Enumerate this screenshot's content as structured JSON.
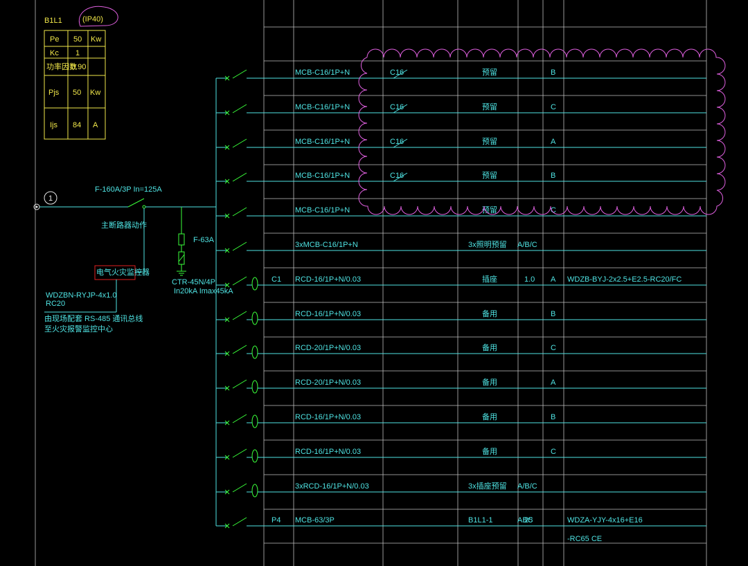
{
  "panel": {
    "name": "B1L1",
    "ip": "(IP40)",
    "table": [
      [
        "Pe",
        "50",
        "Kw"
      ],
      [
        "Kc",
        "1",
        ""
      ],
      [
        "功率因数",
        "0.90",
        ""
      ],
      [
        "Pjs",
        "50",
        "Kw"
      ],
      [
        "Ijs",
        "84",
        "A"
      ]
    ]
  },
  "incoming": {
    "circle_label": "1",
    "breaker": "F-160A/3P In=125A",
    "breaker_note": "主断路器动作",
    "fuse": "F-63A",
    "spd": "CTR-45N/4P",
    "spd_note": "In20kA Imax45kA",
    "monitor": "电气火灾监控器",
    "cable": "WDZBN-RYJP-4x1.0",
    "cable2": "RC20",
    "note1": "由现场配套 RS-485 通讯总线",
    "note2": "至火灾报警监控中心"
  },
  "circuits": [
    {
      "no": "",
      "device": "MCB-C16/1P+N",
      "cloud_device": "C16",
      "use": "预留",
      "kw": "",
      "phase": "B",
      "cable": "",
      "type": "mcb"
    },
    {
      "no": "",
      "device": "MCB-C16/1P+N",
      "cloud_device": "C16",
      "use": "预留",
      "kw": "",
      "phase": "C",
      "cable": "",
      "type": "mcb"
    },
    {
      "no": "",
      "device": "MCB-C16/1P+N",
      "cloud_device": "C16",
      "use": "预留",
      "kw": "",
      "phase": "A",
      "cable": "",
      "type": "mcb"
    },
    {
      "no": "",
      "device": "MCB-C16/1P+N",
      "cloud_device": "C16",
      "use": "预留",
      "kw": "",
      "phase": "B",
      "cable": "",
      "type": "mcb"
    },
    {
      "no": "",
      "device": "MCB-C16/1P+N",
      "cloud_device": "",
      "use": "预留",
      "kw": "",
      "phase": "C",
      "cable": "",
      "type": "mcb"
    },
    {
      "no": "",
      "device": "3xMCB-C16/1P+N",
      "cloud_device": "",
      "use": "3x照明预留",
      "kw": "",
      "phase": "A/B/C",
      "cable": "",
      "type": "mcb"
    },
    {
      "no": "C1",
      "device": "RCD-16/1P+N/0.03",
      "cloud_device": "",
      "use": "插座",
      "kw": "1.0",
      "phase": "A",
      "cable": "WDZB-BYJ-2x2.5+E2.5-RC20/FC",
      "type": "rcd"
    },
    {
      "no": "",
      "device": "RCD-16/1P+N/0.03",
      "cloud_device": "",
      "use": "备用",
      "kw": "",
      "phase": "B",
      "cable": "",
      "type": "rcd"
    },
    {
      "no": "",
      "device": "RCD-20/1P+N/0.03",
      "cloud_device": "",
      "use": "备用",
      "kw": "",
      "phase": "C",
      "cable": "",
      "type": "rcd"
    },
    {
      "no": "",
      "device": "RCD-20/1P+N/0.03",
      "cloud_device": "",
      "use": "备用",
      "kw": "",
      "phase": "A",
      "cable": "",
      "type": "rcd"
    },
    {
      "no": "",
      "device": "RCD-16/1P+N/0.03",
      "cloud_device": "",
      "use": "备用",
      "kw": "",
      "phase": "B",
      "cable": "",
      "type": "rcd"
    },
    {
      "no": "",
      "device": "RCD-16/1P+N/0.03",
      "cloud_device": "",
      "use": "备用",
      "kw": "",
      "phase": "C",
      "cable": "",
      "type": "rcd"
    },
    {
      "no": "",
      "device": "3xRCD-16/1P+N/0.03",
      "cloud_device": "",
      "use": "3x插座预留",
      "kw": "",
      "phase": "A/B/C",
      "cable": "",
      "type": "rcd"
    },
    {
      "no": "P4",
      "device": "MCB-63/3P",
      "cloud_device": "",
      "use": "B1L1-1",
      "kw": "25",
      "phase": "ABC",
      "cable": "WDZA-YJY-4x16+E16",
      "cable2": "-RC65 CE",
      "type": "mcb"
    }
  ],
  "colors": {
    "cyan": "#4fe3e3",
    "yellow": "#f2e84a",
    "green": "#3aff3a",
    "magenta": "#e060e0",
    "red": "#e02020",
    "grid": "#bfbfbf"
  }
}
